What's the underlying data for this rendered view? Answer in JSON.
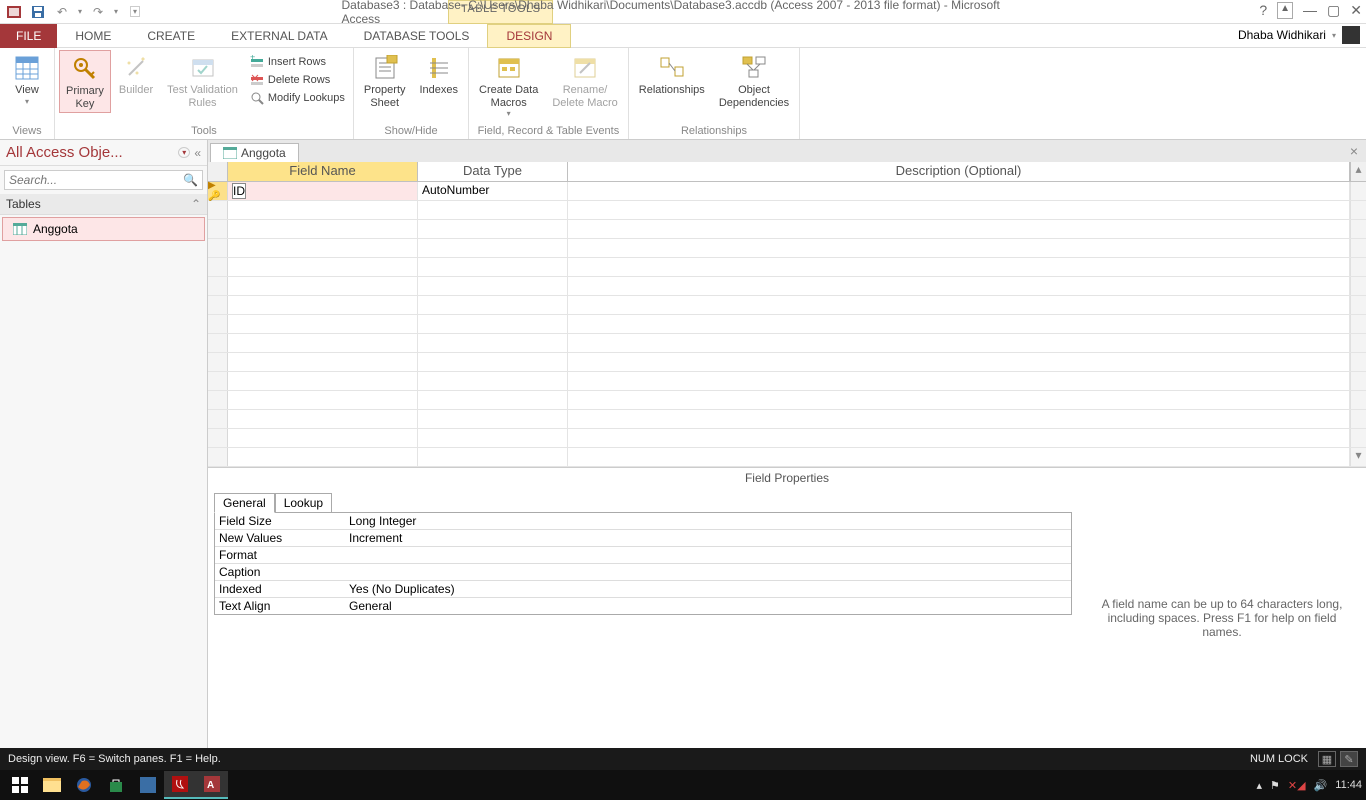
{
  "titlebar": {
    "table_tools": "TABLE TOOLS",
    "title": "Database3 : Database- C:\\Users\\Dhaba Widhikari\\Documents\\Database3.accdb (Access 2007 - 2013 file format) - Microsoft Access",
    "user": "Dhaba Widhikari"
  },
  "tabs": {
    "file": "FILE",
    "home": "HOME",
    "create": "CREATE",
    "external": "EXTERNAL DATA",
    "dbtools": "DATABASE TOOLS",
    "design": "DESIGN"
  },
  "ribbon": {
    "views": {
      "label": "Views",
      "view": "View"
    },
    "tools": {
      "label": "Tools",
      "primary_key": "Primary\nKey",
      "builder": "Builder",
      "test_validation": "Test Validation\nRules",
      "insert_rows": "Insert Rows",
      "delete_rows": "Delete Rows",
      "modify_lookups": "Modify Lookups"
    },
    "showhide": {
      "label": "Show/Hide",
      "property_sheet": "Property\nSheet",
      "indexes": "Indexes"
    },
    "events": {
      "label": "Field, Record & Table Events",
      "create_macros": "Create Data\nMacros",
      "rename_delete": "Rename/\nDelete Macro"
    },
    "relationships": {
      "label": "Relationships",
      "relationships": "Relationships",
      "obj_dep": "Object\nDependencies"
    }
  },
  "navpane": {
    "title": "All Access Obje...",
    "search_placeholder": "Search...",
    "section": "Tables",
    "item": "Anggota"
  },
  "doc": {
    "tab": "Anggota",
    "cols": {
      "field_name": "Field Name",
      "data_type": "Data Type",
      "desc": "Description (Optional)"
    },
    "row": {
      "field": "ID",
      "data_type": "AutoNumber"
    }
  },
  "fprops": {
    "title": "Field Properties",
    "tab_general": "General",
    "tab_lookup": "Lookup",
    "rows": [
      {
        "label": "Field Size",
        "value": "Long Integer"
      },
      {
        "label": "New Values",
        "value": "Increment"
      },
      {
        "label": "Format",
        "value": ""
      },
      {
        "label": "Caption",
        "value": ""
      },
      {
        "label": "Indexed",
        "value": "Yes (No Duplicates)"
      },
      {
        "label": "Text Align",
        "value": "General"
      }
    ],
    "hint": "A field name can be up to 64 characters long, including spaces. Press F1 for help on field names."
  },
  "status": {
    "left": "Design view.   F6 = Switch panes.   F1 = Help.",
    "numlock": "NUM LOCK"
  },
  "taskbar": {
    "time": "11:44"
  }
}
